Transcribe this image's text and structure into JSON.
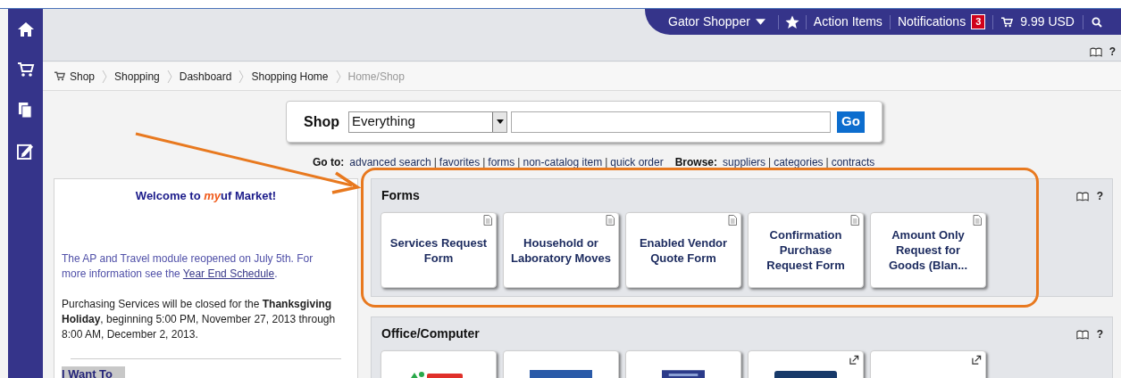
{
  "header": {
    "user_menu": "Gator Shopper",
    "action_items": "Action Items",
    "notifications": "Notifications",
    "notification_count": "3",
    "cart_total": "9.99 USD",
    "help": "?"
  },
  "breadcrumb": [
    {
      "label": "Shop",
      "current": false
    },
    {
      "label": "Shopping",
      "current": false
    },
    {
      "label": "Dashboard",
      "current": false
    },
    {
      "label": "Shopping Home",
      "current": false
    },
    {
      "label": "Home/Shop",
      "current": true
    }
  ],
  "search": {
    "label": "Shop",
    "scope": "Everything",
    "button": "Go"
  },
  "goto": {
    "label": "Go to:",
    "separator": "|",
    "links": [
      "advanced search",
      "favorites",
      "forms",
      "non-catalog item",
      "quick order"
    ]
  },
  "browse": {
    "label": "Browse:",
    "separator": "|",
    "links": [
      "suppliers",
      "categories",
      "contracts"
    ]
  },
  "welcome": {
    "title_start": "Welcome to ",
    "title_brand": "my",
    "title_end": "uf Market!",
    "notice_before": "The AP and Travel module reopened on July 5th. For more information see the ",
    "notice_link": "Year End Schedule",
    "notice_after": ".",
    "closure": "Purchasing Services will be closed for the **Thanksgiving Holiday**, beginning 5:00 PM, November 27, 2013 through 8:00 AM, December 2, 2013.",
    "section": "I Want To"
  },
  "panels": [
    {
      "title": "Forms",
      "help": "?",
      "highlighted": true,
      "tiles": [
        {
          "kind": "form",
          "label": "Services Request Form"
        },
        {
          "kind": "form",
          "label": "Household or Laboratory Moves"
        },
        {
          "kind": "form",
          "label": "Enabled Vendor Quote Form"
        },
        {
          "kind": "form",
          "label": "Confirmation Purchase Request Form"
        },
        {
          "kind": "form",
          "label": "Amount Only Request for Goods (Blan..."
        }
      ]
    },
    {
      "title": "Office/Computer",
      "help": "?",
      "highlighted": false,
      "tiles": [
        {
          "kind": "supplier",
          "external": false
        },
        {
          "kind": "supplier",
          "external": false
        },
        {
          "kind": "supplier",
          "external": false
        },
        {
          "kind": "supplier",
          "external": true
        },
        {
          "kind": "supplier",
          "external": true
        }
      ]
    }
  ]
}
